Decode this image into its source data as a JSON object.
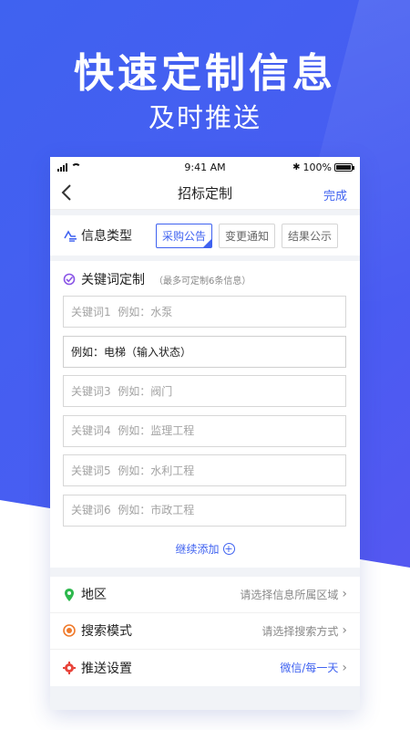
{
  "hero": {
    "title": "快速定制信息",
    "subtitle": "及时推送"
  },
  "statusbar": {
    "time": "9:41 AM",
    "battery": "100%"
  },
  "navbar": {
    "back_icon": "chevron-left-icon",
    "title": "招标定制",
    "done_label": "完成"
  },
  "info_type": {
    "label": "信息类型",
    "options": [
      {
        "label": "采购公告",
        "selected": true
      },
      {
        "label": "变更通知",
        "selected": false
      },
      {
        "label": "结果公示",
        "selected": false
      }
    ]
  },
  "keywords": {
    "label": "关键词定制",
    "hint": "（最多可定制6条信息）",
    "fields": [
      {
        "value": "",
        "placeholder": "关键词1  例如：水泵"
      },
      {
        "value": "例如：电梯（输入状态）",
        "placeholder": ""
      },
      {
        "value": "",
        "placeholder": "关键词3  例如：阀门"
      },
      {
        "value": "",
        "placeholder": "关键词4  例如：监理工程"
      },
      {
        "value": "",
        "placeholder": "关键词5  例如：水利工程"
      },
      {
        "value": "",
        "placeholder": "关键词6  例如：市政工程"
      }
    ],
    "add_more_label": "继续添加"
  },
  "settings": [
    {
      "label": "地区",
      "value": "请选择信息所属区域",
      "icon": "location-pin-icon"
    },
    {
      "label": "搜索模式",
      "value": "请选择搜索方式",
      "icon": "target-icon"
    },
    {
      "label": "推送设置",
      "value": "微信/每一天",
      "icon": "gear-icon"
    }
  ],
  "colors": {
    "accent": "#3f62f0",
    "location": "#2db84d",
    "search": "#f07a2a",
    "push": "#e8453c"
  }
}
